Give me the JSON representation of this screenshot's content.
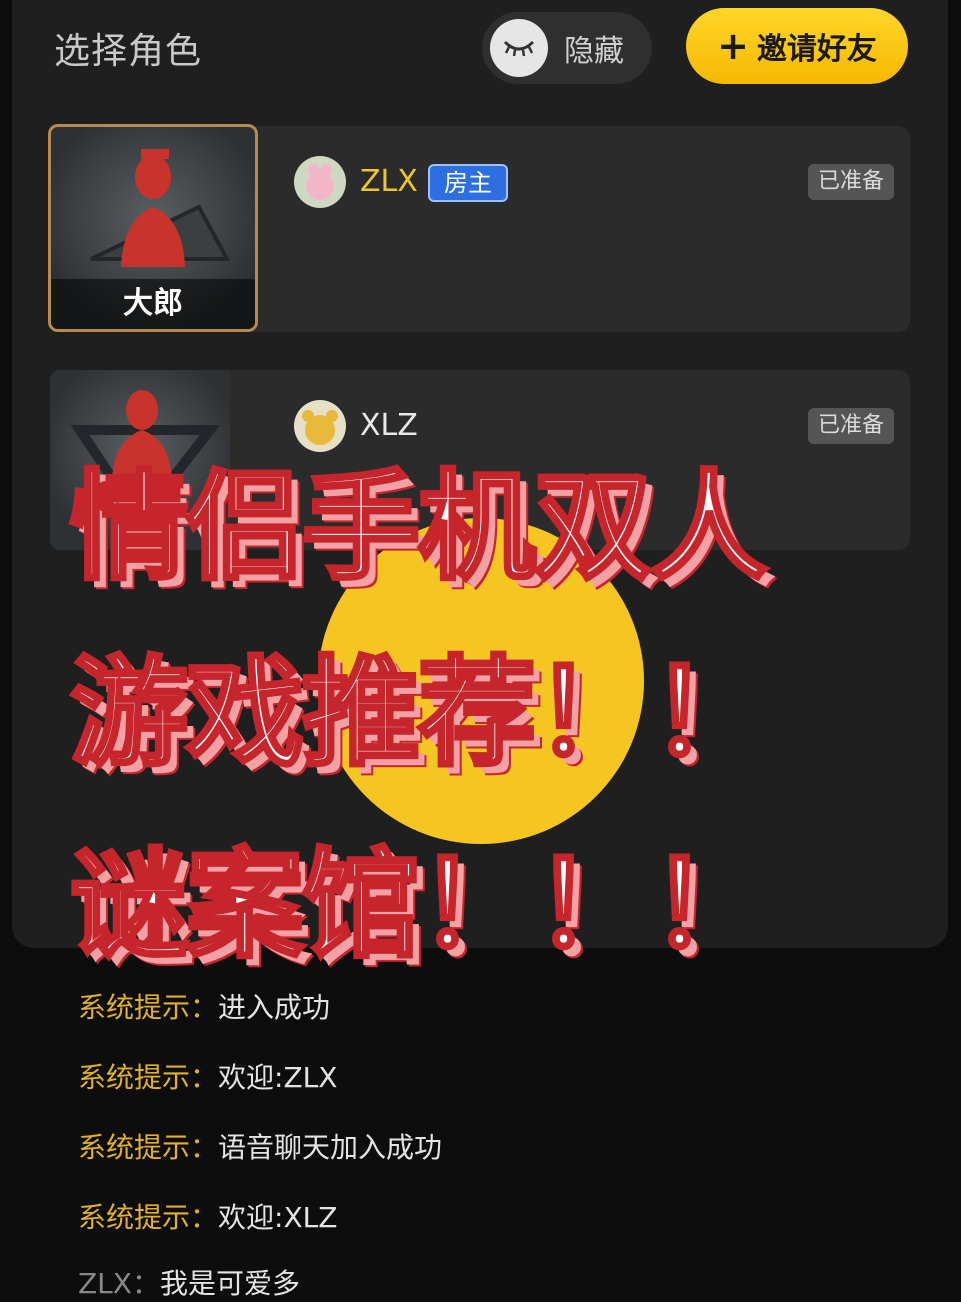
{
  "header": {
    "title": "选择角色",
    "hide_label": "隐藏",
    "invite_label": "邀请好友",
    "invite_icon": "plus-icon"
  },
  "roles": [
    {
      "role_name": "大郎",
      "player": "ZLX",
      "badge": "房主",
      "status": "已准备"
    },
    {
      "role_name": "",
      "player": "XLZ",
      "status": "已准备"
    }
  ],
  "overlay": {
    "line1": "情侣手机双人",
    "line2": "游戏推荐！！",
    "line3": "谜案馆！！！"
  },
  "chat": [
    {
      "who": "系统提示：",
      "text": "进入成功"
    },
    {
      "who": "系统提示：",
      "text": "欢迎:ZLX"
    },
    {
      "who": "系统提示：",
      "text": "语音聊天加入成功"
    },
    {
      "who": "系统提示：",
      "text": "欢迎:XLZ"
    },
    {
      "who": "ZLX：",
      "text": "我是可爱多"
    }
  ],
  "colors": {
    "accent_yellow": "#f5c521",
    "host_blue": "#2d6ee0",
    "overlay_red": "#c7252c"
  }
}
